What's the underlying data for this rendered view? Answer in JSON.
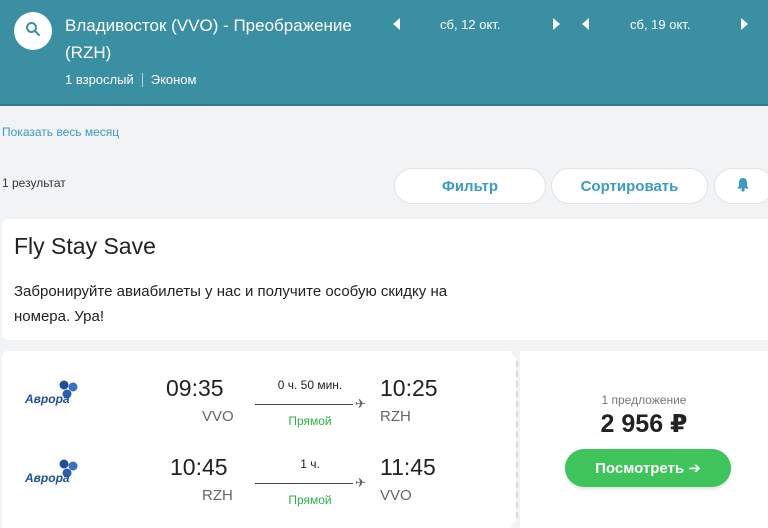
{
  "header": {
    "route": "Владивосток (VVO) - Преображение (RZH)",
    "passengers": "1 взрослый",
    "cabin_class": "Эконом",
    "depart_date": "сб, 12 окт.",
    "return_date": "сб, 19 окт.",
    "accent_color": "#3a8fa3"
  },
  "show_month_label": "Показать весь месяц",
  "results": {
    "count_label": "1 результат",
    "filter_label": "Фильтр",
    "sort_label": "Сортировать"
  },
  "promo": {
    "title": "Fly Stay Save",
    "text": "Забронируйте авиабилеты у нас и получите особую скидку на номера. Ура!"
  },
  "ticket": {
    "airline": "Аврора",
    "segments": [
      {
        "dep_time": "09:35",
        "dep_code": "VVO",
        "duration": "0 ч. 50 мин.",
        "stops": "Прямой",
        "arr_time": "10:25",
        "arr_code": "RZH"
      },
      {
        "dep_time": "10:45",
        "dep_code": "RZH",
        "duration": "1 ч.",
        "stops": "Прямой",
        "arr_time": "11:45",
        "arr_code": "VVO"
      }
    ],
    "offers": "1 предложение",
    "price": "2 956 ₽",
    "view_button": "Посмотреть ➔",
    "button_color": "#3fc35b"
  }
}
